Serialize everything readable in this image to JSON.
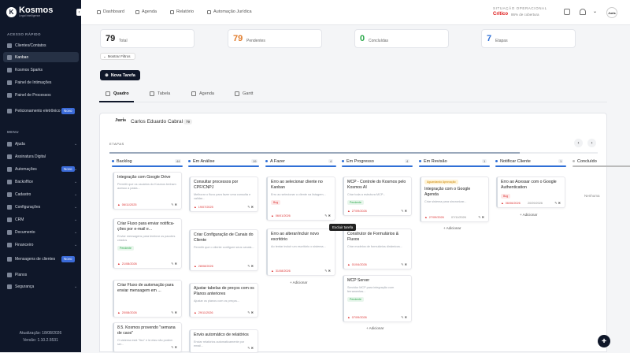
{
  "app": {
    "name": "Kosmos",
    "tagline": "Legal Intelligence"
  },
  "sidebar": {
    "section_quick": "ACESSO RÁPIDO",
    "quick": [
      "Clientes/Contatos",
      "Kanban",
      "Kosmos Sparks",
      "Painel de Intimações",
      "Painel de Processos",
      "Peticionamento eletrônico"
    ],
    "badge_new": "Novo",
    "section_menu": "MENU",
    "menu": [
      "Ajuda",
      "Assinatura Digital",
      "Automações",
      "Backoffice",
      "Cadastro",
      "Configurações",
      "CRM",
      "Documento",
      "Financeiro",
      "Mensagens de clientes",
      "Planos",
      "Segurança"
    ],
    "updated": "Atualização: 18/08/2026",
    "version": "Versão: 1.10.2.5531"
  },
  "topbar": {
    "nav": [
      "Dashboard",
      "Agenda",
      "Relatório",
      "Automação Jurídica"
    ],
    "status_label": "SITUAÇÃO OPERACIONAL",
    "status_value": "Crítico",
    "coverage": "86% de cobertura",
    "avatar": "Juris"
  },
  "stats": [
    {
      "value": "79",
      "label": "Total",
      "color": "#222"
    },
    {
      "value": "79",
      "label": "Pendentes",
      "color": "#e07b2a"
    },
    {
      "value": "0",
      "label": "Concluídas",
      "color": "#2aa84a"
    },
    {
      "value": "7",
      "label": "Etapas",
      "color": "#2f6fd6"
    }
  ],
  "filters_label": "Mostrar Filtros",
  "new_task_label": "Nova Tarefa",
  "views": [
    "Quadro",
    "Tabela",
    "Agenda",
    "Gantt"
  ],
  "board": {
    "logo": "Juris",
    "name": "Carlos Eduardo Cabral",
    "count": "79",
    "stages_label": "ETAPAS",
    "empty": "Nenhuma",
    "tooltip": "Excluir tarefa",
    "add": "+ Adicionar",
    "prev": "‹",
    "next": "›"
  },
  "columns": [
    {
      "title": "Backlog",
      "count": "44",
      "color": "#2f6fd6"
    },
    {
      "title": "Em Análise",
      "count": "19",
      "color": "#2f6fd6"
    },
    {
      "title": "A Fazer",
      "count": "4",
      "color": "#2f6fd6"
    },
    {
      "title": "Em Progresso",
      "count": "4",
      "color": "#2f6fd6"
    },
    {
      "title": "Em Revisão",
      "count": "1",
      "color": "#2f6fd6"
    },
    {
      "title": "Notificar Cliente",
      "count": "1",
      "color": "#2f6fd6"
    },
    {
      "title": "Concluído",
      "count": "",
      "color": "#bbbbbb"
    }
  ],
  "cards": [
    {
      "title": "Integração com Google Drive",
      "desc": "Permitir que os usuários do Kosmos tenham acesso a pasta...",
      "tag": "",
      "date": "06/11/2025"
    },
    {
      "title": "Criar Fluxo para enviar notifica-ções por e-mail e...",
      "desc": "Enviar mensagens para lembrar os pacotes criados",
      "tag": "Pendente",
      "date": "21/08/2026"
    },
    {
      "title": "Criar Fluxo de automação para enviar mensagem em ...",
      "desc": "",
      "tag": "",
      "date": "20/08/2026"
    },
    {
      "title": "8.5. Kosmos provendo \"semana de caos\"",
      "desc": "O sistema está \"fixo\" e lá elas não podem ser...",
      "tag": "",
      "date": ""
    },
    {
      "title": "Consultar processos por CPF/CNPJ",
      "desc": "Melhorar o fluxo para fazer uma consulta e validar...",
      "tag": "",
      "date": "19/07/2025"
    },
    {
      "title": "Criar Configuração de Canais do Cliente",
      "desc": "Permitir que o cliente configure seus canais...",
      "tag": "",
      "date": "28/08/2026"
    },
    {
      "title": "Ajustar tabelas de preços com os Planos anteriores",
      "desc": "Ajustar os planos com os preços...",
      "tag": "",
      "date": "29/11/2026"
    },
    {
      "title": "Envio automático de relatórios",
      "desc": "Enviar relatórios automaticamente por email...",
      "tag": "",
      "date": ""
    },
    {
      "title": "Erro ao selecionar cliente no Kanban",
      "desc": "Erro ao selecionar o cliente na listagem...",
      "tag": "Bug",
      "date": "06/01/2026"
    },
    {
      "title": "Erro ao alterar/incluir novo escritório",
      "desc": "Ao tentar incluir um escritório o sistema...",
      "tag": "",
      "date": "31/08/2026"
    },
    {
      "title": "MCP - Controle do Kosmos pelo Kosmos AI",
      "desc": "Criar toda a estrutura MCP...",
      "tag": "Pendente",
      "date": "27/09/2026"
    },
    {
      "title": "Construtor de Formulários & Fluxos",
      "desc": "Criar modelos de formulários dinâmicos...",
      "tag": "",
      "date": "01/04/2026"
    },
    {
      "title": "MCP Server",
      "desc": "Servidor MCP para integração com ferramentas...",
      "tag": "Pendente",
      "date": "07/09/2026"
    },
    {
      "title": "Integração com o Google Agenda",
      "desc": "Criar sistema para sincronizar...",
      "tag": "Aguardando Aprovação",
      "date": "27/09/2026",
      "date2": "07/11/2026"
    },
    {
      "title": "Erro ao Acessar com o Google Authentication",
      "desc": "",
      "tag": "Bug",
      "date": "06/06/2026",
      "date2": "20/09/2026"
    }
  ]
}
